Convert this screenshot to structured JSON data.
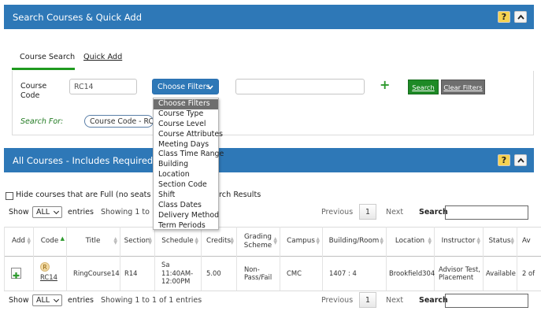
{
  "top_panel": {
    "title": "Search Courses & Quick Add",
    "help": "?",
    "collapse": "^"
  },
  "tabs": [
    {
      "label": "Course Search"
    },
    {
      "label": "Quick Add"
    }
  ],
  "search": {
    "field_label": "Course Code",
    "value": "RC14",
    "filter_select": "Choose Filters",
    "filter_value": "",
    "add": "+",
    "search_btn": "Search",
    "clear_btn": "Clear Filters",
    "search_for_label": "Search For:",
    "search_for_chip": "Course Code - RC14"
  },
  "dropdown": {
    "options": [
      "Choose Filters",
      "Course Type",
      "Course Level",
      "Course Attributes",
      "Meeting Days",
      "Class Time Range",
      "Building",
      "Location",
      "Section Code",
      "Shift",
      "Class Dates",
      "Delivery Method",
      "Term Periods"
    ]
  },
  "courses_panel": {
    "title": "All Courses - Includes Required and E",
    "help": "?",
    "collapse": "^"
  },
  "hide_full": {
    "label_start": "Hide courses that are Full (no seats are av",
    "label_end": "rch Results"
  },
  "pager": {
    "show": "Show",
    "length": "ALL",
    "entries": "entries",
    "info_top": "Showing 1 to 1",
    "info_bottom": "Showing 1 to 1 of 1 entries",
    "previous": "Previous",
    "page": "1",
    "next": "Next",
    "search_label": "Search"
  },
  "table": {
    "headers": [
      "Add",
      "Code",
      "Title",
      "Section",
      "Schedule",
      "Credits",
      "Grading Scheme",
      "Campus",
      "Building/Room",
      "Location",
      "Instructor",
      "Status",
      "Av"
    ],
    "row": {
      "badge": "R",
      "code": "RC14",
      "title": "RingCourse14",
      "section": "R14",
      "schedule": [
        "Sa",
        "11:40AM-",
        "12:00PM"
      ],
      "credits": "5.00",
      "grading": [
        "Non-",
        "Pass/Fail"
      ],
      "campus": "CMC",
      "room": "1407 : 4",
      "location": "Brookfield304",
      "instructor": [
        "Advisor Test,",
        "Placement"
      ],
      "status": "Available",
      "avail": "2 of"
    }
  },
  "colors": {
    "header": "#2e78b7",
    "tab_active": "#1f9a1f",
    "search_btn": "#1e8a26",
    "clear_btn": "#6f6f6f"
  }
}
